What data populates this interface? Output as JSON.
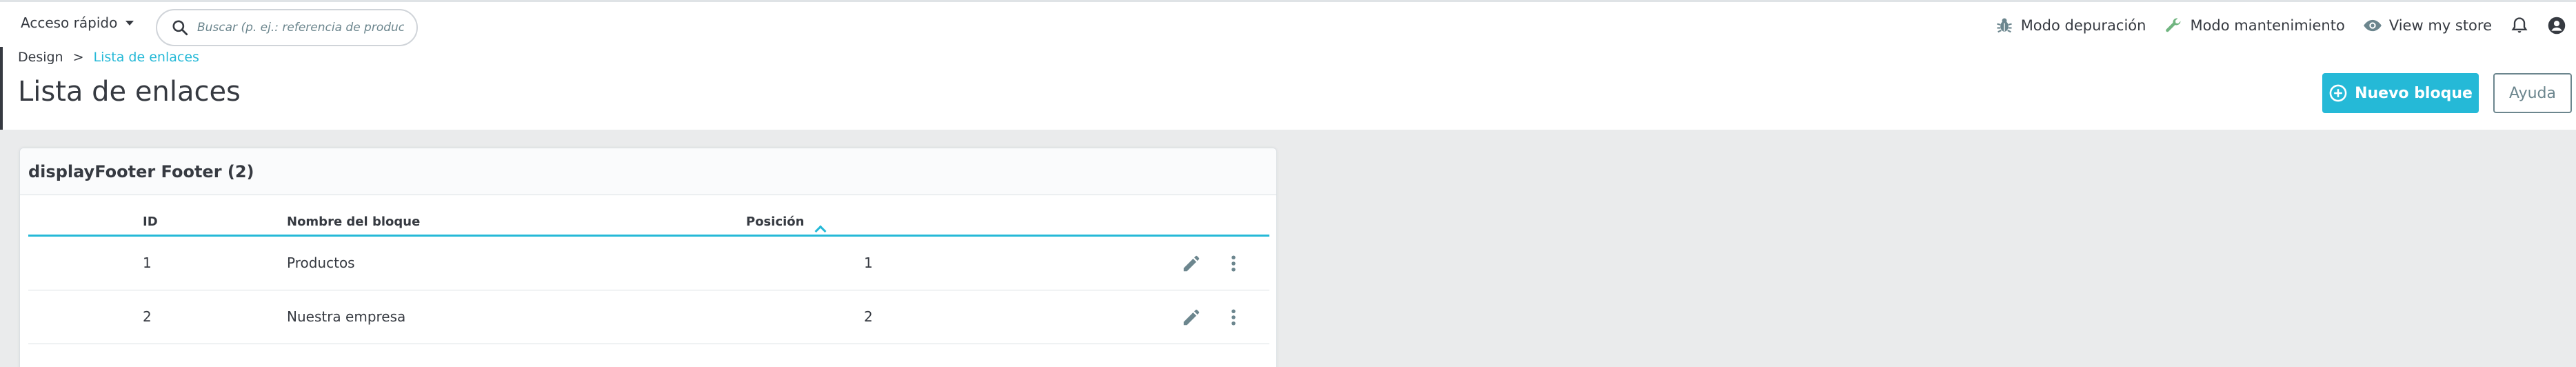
{
  "topbar": {
    "quick_access_label": "Acceso rápido",
    "search_placeholder": "Buscar (p. ej.: referencia de producto, ...",
    "debug_mode_label": "Modo depuración",
    "maintenance_mode_label": "Modo mantenimiento",
    "view_store_label": "View my store"
  },
  "breadcrumb": {
    "parent": "Design",
    "separator": ">",
    "current": "Lista de enlaces"
  },
  "page": {
    "title": "Lista de enlaces",
    "new_block_label": "Nuevo bloque",
    "help_label": "Ayuda"
  },
  "card": {
    "title": "displayFooter Footer (2)",
    "columns": {
      "id": "ID",
      "name": "Nombre del bloque",
      "position": "Posición"
    },
    "rows": [
      {
        "id": "1",
        "name": "Productos",
        "position": "1"
      },
      {
        "id": "2",
        "name": "Nuestra empresa",
        "position": "2"
      }
    ]
  },
  "colors": {
    "accent": "#25b9d7",
    "text": "#363a41",
    "page_bg": "#eaebec"
  },
  "icons": [
    "caret-down-icon",
    "search-icon",
    "bug-icon",
    "wrench-icon",
    "eye-icon",
    "bell-icon",
    "user-icon",
    "plus-circle-icon",
    "sort-asc-icon",
    "pencil-icon",
    "more-vert-icon"
  ]
}
